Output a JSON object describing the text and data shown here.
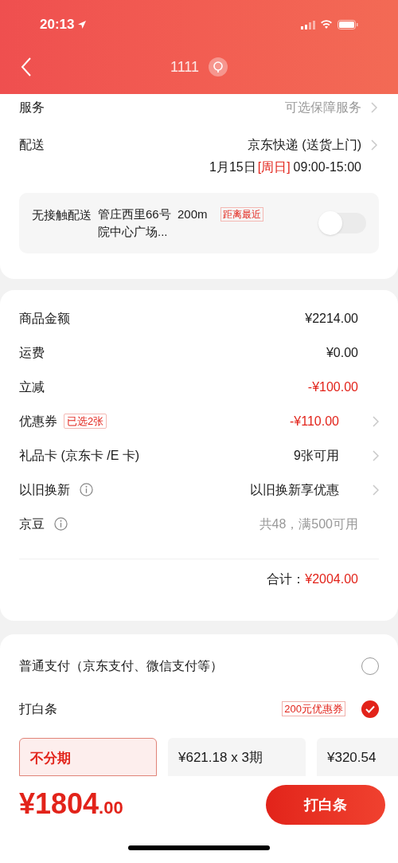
{
  "status_bar": {
    "time": "20:13"
  },
  "nav": {
    "title": "1111"
  },
  "service": {
    "label": "服务",
    "value": "可选保障服务"
  },
  "delivery": {
    "label": "配送",
    "carrier": "京东快递 (送货上门)",
    "date": "1月15日",
    "weekday": "[周日]",
    "time": "09:00-15:00"
  },
  "contactless": {
    "label": "无接触配送",
    "address": "管庄西里66号  200m",
    "address_line2": "院中心广场...",
    "tag": "距离最近",
    "on": false
  },
  "summary": [
    {
      "label": "商品金额",
      "value": "¥2214.00",
      "kind": "amount",
      "arrow": false
    },
    {
      "label": "运费",
      "value": "¥0.00",
      "kind": "amount",
      "arrow": false
    },
    {
      "label": "立减",
      "value": "-¥100.00",
      "kind": "discount",
      "arrow": false
    },
    {
      "label": "优惠券",
      "badge": "已选2张",
      "value": "-¥110.00",
      "kind": "discount",
      "arrow": true
    },
    {
      "label": "礼品卡 (京东卡 /E 卡)",
      "value": "9张可用",
      "kind": "amount",
      "arrow": true
    },
    {
      "label": "以旧换新",
      "info": true,
      "value": "以旧换新享优惠",
      "kind": "amount",
      "arrow": true
    },
    {
      "label": "京豆",
      "info": true,
      "value": "共48，满500可用",
      "kind": "hint",
      "arrow": false
    }
  ],
  "total": {
    "label": "合计：",
    "value": "¥2004.00"
  },
  "payment_methods": [
    {
      "label": "普通支付（京东支付、微信支付等）",
      "selected": false
    },
    {
      "label": "打白条",
      "tag": "200元优惠券",
      "selected": true
    }
  ],
  "installments": [
    {
      "title": "不分期",
      "selected": true
    },
    {
      "title": "¥621.18 x 3期",
      "selected": false
    },
    {
      "title": "¥320.54",
      "selected": false
    }
  ],
  "bottom_bar": {
    "price_main": "¥1804",
    "price_decimal": ".00",
    "button": "打白条"
  }
}
